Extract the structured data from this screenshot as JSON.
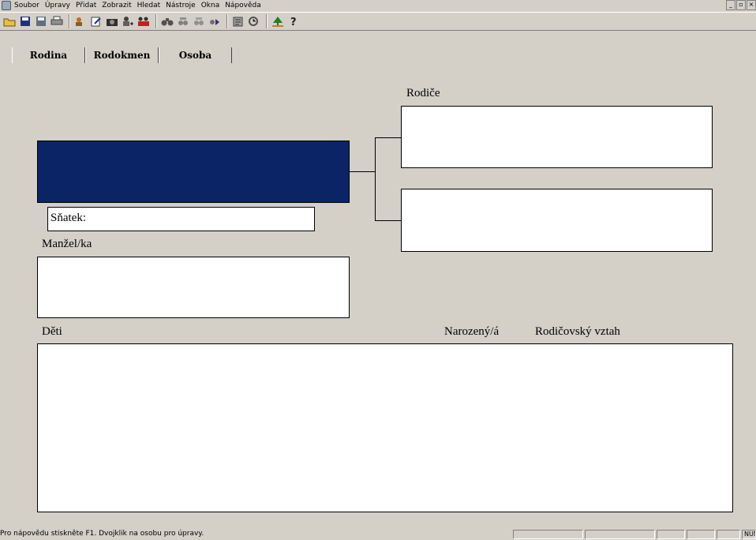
{
  "menu": [
    "Soubor",
    "Úpravy",
    "Přidat",
    "Zobrazit",
    "Hledat",
    "Nástroje",
    "Okna",
    "Nápověda"
  ],
  "window_controls": [
    "_",
    "▫",
    "×"
  ],
  "toolbar": {
    "icons": [
      "open-folder-icon",
      "save-icon",
      "save-as-icon",
      "print-icon",
      "add-person-icon",
      "edit-icon",
      "camera-icon",
      "person-add-icon",
      "family-add-icon",
      "binoculars-icon",
      "find-next-icon",
      "find-family-icon",
      "go-icon",
      "report-icon",
      "timeline-icon",
      "tree-icon",
      "help-icon"
    ]
  },
  "tabs": [
    "Rodina",
    "Rodokmen",
    "Osoba"
  ],
  "labels": {
    "parents": "Rodiče",
    "marriage": "Sňatek:",
    "spouse": "Manžel/ka",
    "children": "Děti",
    "born": "Narozený/á",
    "relation": "Rodičovský vztah"
  },
  "colors": {
    "selected_person": "#0a2466",
    "background": "#d4d0c8"
  },
  "statusbar": {
    "text": "Pro nápovědu stiskněte F1. Dvojklik na osobu pro úpravy.",
    "num": "NUM"
  }
}
